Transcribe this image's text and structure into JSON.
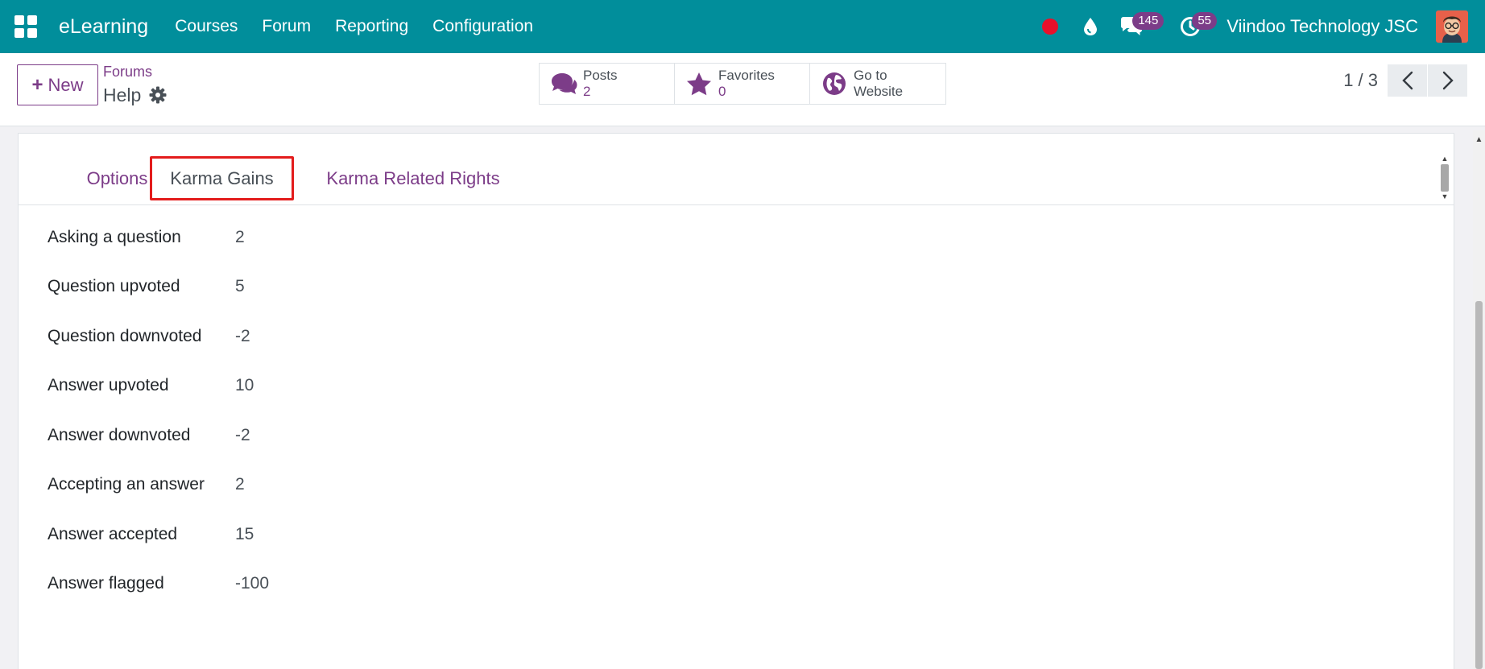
{
  "navbar": {
    "brand": "eLearning",
    "menu": [
      "Courses",
      "Forum",
      "Reporting",
      "Configuration"
    ],
    "chat_badge": "145",
    "activity_badge": "55",
    "company": "Viindoo Technology JSC",
    "colors": {
      "bg": "#018e9b",
      "badge": "#7c3c88",
      "record_dot": "#e8102b"
    }
  },
  "control": {
    "new_label": "New",
    "breadcrumb": "Forums",
    "record_name": "Help",
    "smart_buttons": [
      {
        "label": "Posts",
        "value": "2",
        "icon": "comments-icon"
      },
      {
        "label": "Favorites",
        "value": "0",
        "icon": "star-icon"
      },
      {
        "label": "Go to",
        "label2": "Website",
        "icon": "globe-icon"
      }
    ],
    "pager": "1 / 3"
  },
  "tabs": [
    {
      "label": "Options",
      "active": false
    },
    {
      "label": "Karma Gains",
      "active": true
    },
    {
      "label": "Karma Related Rights",
      "active": false
    }
  ],
  "fields": [
    {
      "label": "Asking a question",
      "value": "2"
    },
    {
      "label": "Question upvoted",
      "value": "5"
    },
    {
      "label": "Question downvoted",
      "value": "-2"
    },
    {
      "label": "Answer upvoted",
      "value": "10"
    },
    {
      "label": "Answer downvoted",
      "value": "-2"
    },
    {
      "label": "Accepting an answer",
      "value": "2"
    },
    {
      "label": "Answer accepted",
      "value": "15"
    },
    {
      "label": "Answer flagged",
      "value": "-100"
    }
  ],
  "accent_color": "#7c3c88"
}
